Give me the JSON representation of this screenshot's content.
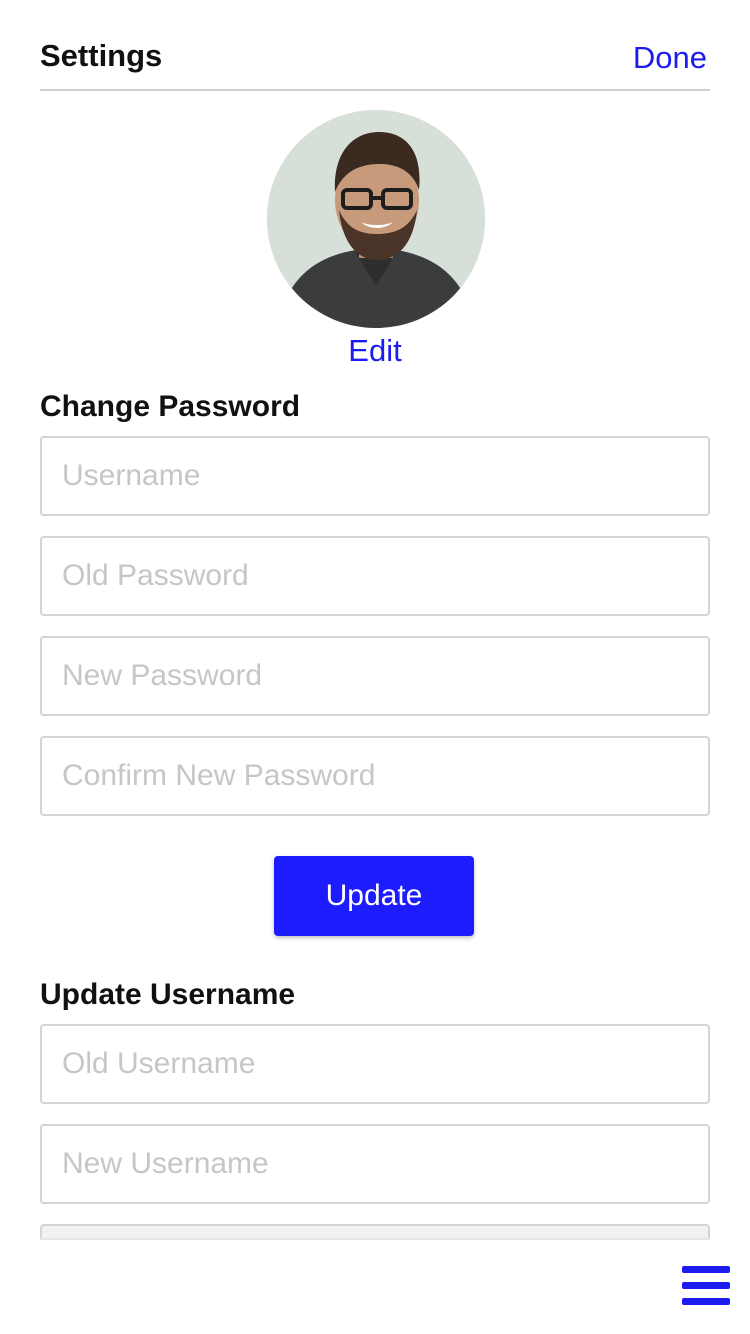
{
  "header": {
    "title": "Settings",
    "done_label": "Done"
  },
  "profile": {
    "edit_label": "Edit",
    "avatar_icon": "user-avatar-photo"
  },
  "change_password": {
    "title": "Change Password",
    "fields": [
      {
        "placeholder": "Username",
        "value": ""
      },
      {
        "placeholder": "Old Password",
        "value": ""
      },
      {
        "placeholder": "New Password",
        "value": ""
      },
      {
        "placeholder": "Confirm New Password",
        "value": ""
      }
    ],
    "submit_label": "Update"
  },
  "update_username": {
    "title": "Update Username",
    "fields": [
      {
        "placeholder": "Old Username",
        "value": ""
      },
      {
        "placeholder": "New Username",
        "value": ""
      }
    ]
  },
  "nav": {
    "menu_icon": "hamburger-menu-icon"
  },
  "colors": {
    "accent": "#1c1cf0",
    "button": "#1c1cff",
    "field_border": "#d4d4d4",
    "placeholder": "#c6c6c6"
  }
}
